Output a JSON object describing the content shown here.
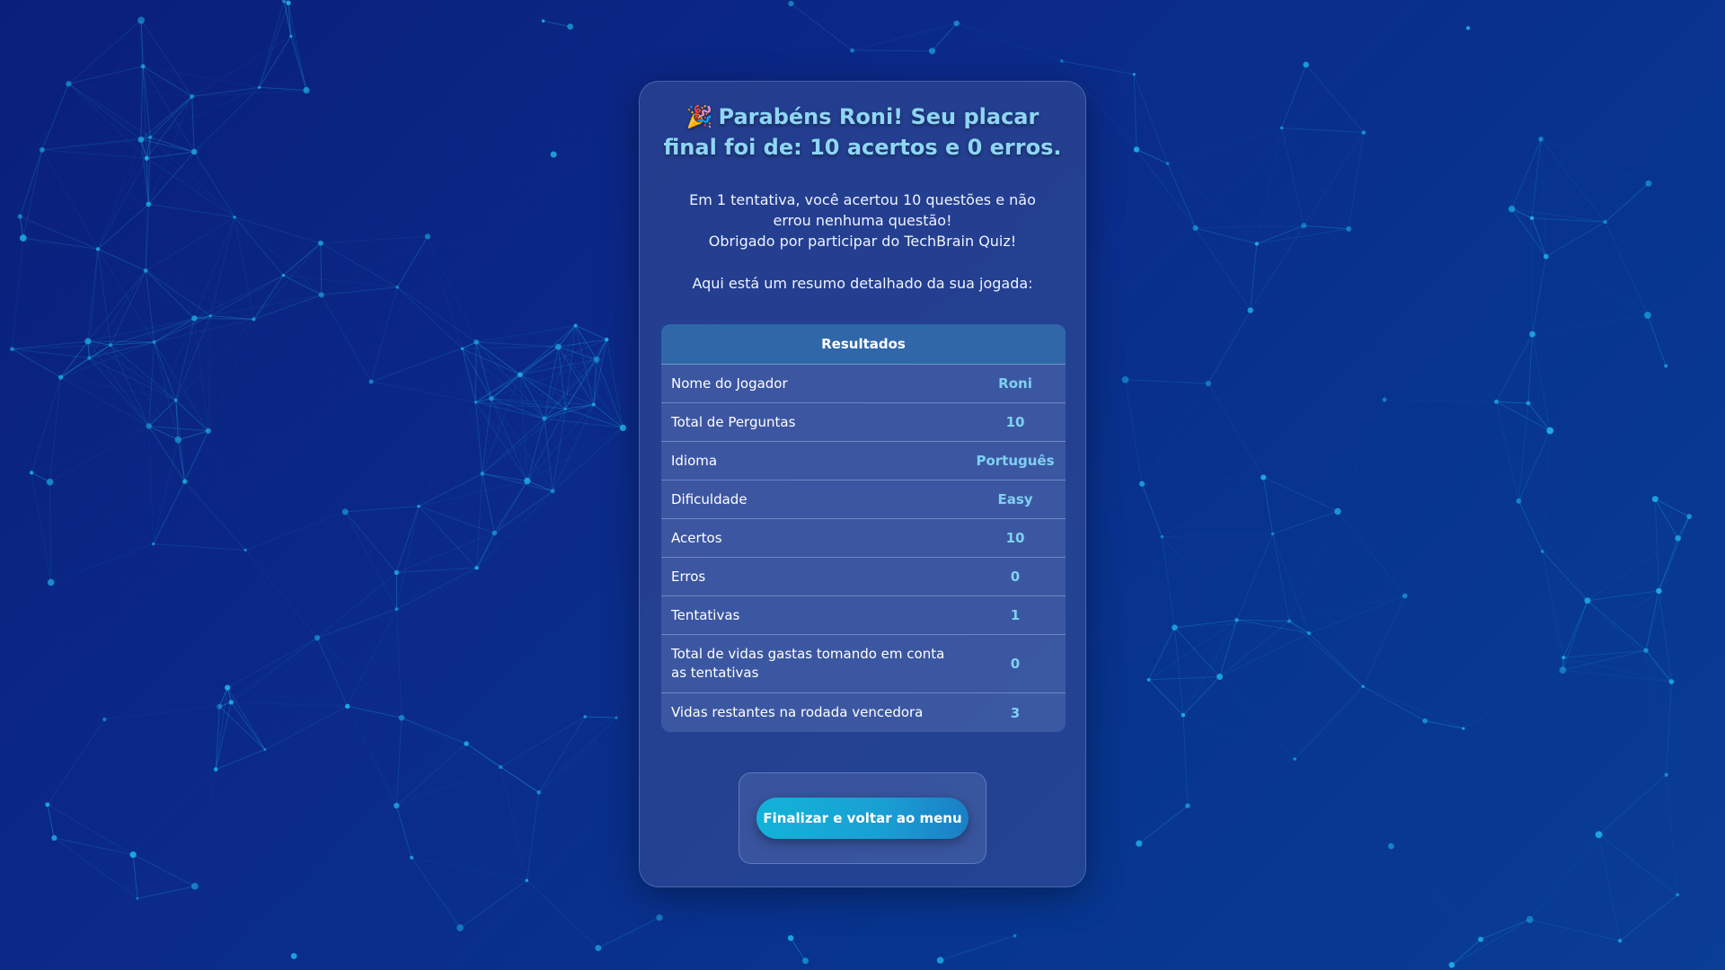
{
  "result": {
    "title_icon": "🎉",
    "title": "Parabéns Roni! Seu placar final foi de: 10 acertos e 0 erros.",
    "message_line1": "Em 1 tentativa, você acertou 10 questões e não errou nenhuma questão!",
    "message_line2": "Obrigado por participar do TechBrain Quiz!",
    "summary_intro": "Aqui está um resumo detalhado da sua jogada:"
  },
  "table": {
    "header": "Resultados",
    "rows": [
      {
        "label": "Nome do Jogador",
        "value": "Roni"
      },
      {
        "label": "Total de Perguntas",
        "value": "10"
      },
      {
        "label": "Idioma",
        "value": "Português"
      },
      {
        "label": "Dificuldade",
        "value": "Easy"
      },
      {
        "label": "Acertos",
        "value": "10"
      },
      {
        "label": "Erros",
        "value": "0"
      },
      {
        "label": "Tentativas",
        "value": "1"
      },
      {
        "label": "Total de vidas gastas tomando em conta as tentativas",
        "value": "0"
      },
      {
        "label": "Vidas restantes na rodada vencedora",
        "value": "3"
      }
    ]
  },
  "actions": {
    "finish_label": "Finalizar e voltar ao menu"
  },
  "colors": {
    "background": "#0b2a8a",
    "accent": "#7fd0f2",
    "button": "#12b3d8",
    "network": "#1fb6e6"
  }
}
